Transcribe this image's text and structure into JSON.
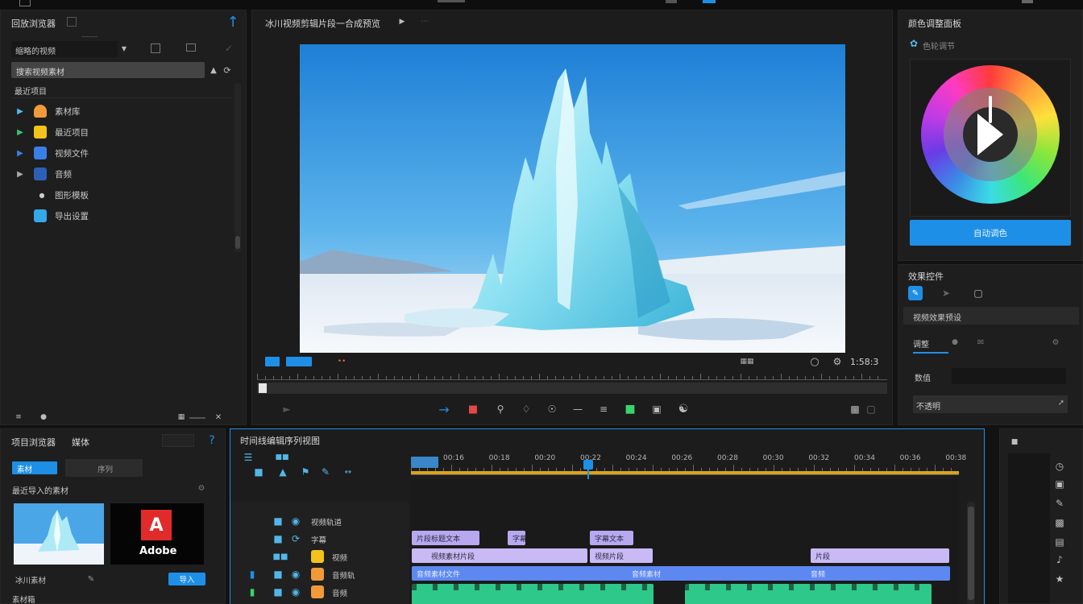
{
  "top_menu": {
    "left_icon": "window-icon"
  },
  "left_panel": {
    "title": "回放浏览器",
    "dropdown_value": "缩略的视频",
    "search_placeholder": "搜索视频素材",
    "section_label": "最近项目",
    "items": [
      {
        "label": "素材库",
        "icon": "folder-orange-icon",
        "color": "#f19a3a"
      },
      {
        "label": "最近项目",
        "icon": "folder-yellow-icon",
        "color": "#f3c21c"
      },
      {
        "label": "视频文件",
        "icon": "folder-blue-icon",
        "color": "#3a7ee8"
      },
      {
        "label": "音频",
        "icon": "folder-navy-icon",
        "color": "#2e5fb8"
      },
      {
        "label": "图形模板",
        "icon": "dot-icon",
        "color": "#cccccc"
      },
      {
        "label": "导出设置",
        "icon": "image-icon",
        "color": "#35a8e8"
      }
    ]
  },
  "viewer": {
    "title": "冰川视频剪辑片段一合成预览",
    "timecode": "1:58:3",
    "in_label": "入点",
    "out_label": "出点"
  },
  "color_panel": {
    "title": "颜色调整面板",
    "subtitle": "色轮调节",
    "apply_button": "自动调色"
  },
  "effects_panel": {
    "title": "效果控件",
    "section": "视频效果预设",
    "tab": "调整",
    "field_label": "数值",
    "field2_label": "不透明"
  },
  "project_panel": {
    "title": "项目浏览器",
    "title2": "媒体",
    "tab_active": "素材",
    "tab_inactive": "序列",
    "section": "最近导入的素材",
    "thumb1_label": "冰川素材",
    "thumb2_label": "Adobe",
    "import_button": "导入",
    "footer_label": "素材箱"
  },
  "timeline": {
    "title": "时间线编辑序列视图",
    "ruler_labels": [
      "00:16",
      "00:18",
      "00:20",
      "00:22",
      "00:24",
      "00:26",
      "00:28",
      "00:30",
      "00:32",
      "00:34",
      "00:36",
      "00:38"
    ],
    "tracks": [
      {
        "name": "视频轨道"
      },
      {
        "name": "字幕"
      },
      {
        "name": "视频"
      },
      {
        "name": "音频轨"
      },
      {
        "name": "音频"
      }
    ],
    "clips_row1": [
      "片段标题文本",
      "字幕",
      "字幕文本"
    ],
    "clips_row2": [
      "视频素材片段",
      "视频片段",
      "片段"
    ],
    "clips_row3": [
      "音频素材文件",
      "音频素材",
      "音频"
    ]
  },
  "colors": {
    "accent": "#1e8fe6",
    "bg": "#121212",
    "panel": "#1e1e1e"
  }
}
